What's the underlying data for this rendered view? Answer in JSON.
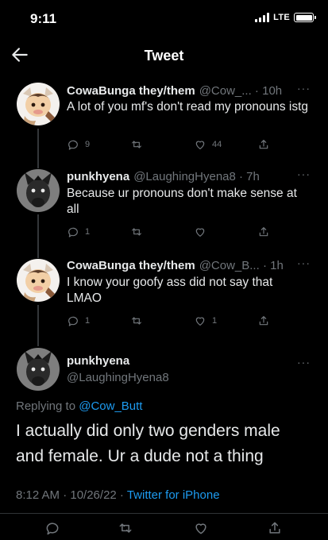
{
  "status_bar": {
    "time": "9:11",
    "network": "LTE"
  },
  "header": {
    "title": "Tweet"
  },
  "thread": [
    {
      "name": "CowaBunga they/them",
      "meta": "@Cow_... · 10h",
      "text": "A lot of you mf's don't read my pronouns istg",
      "replies": "9",
      "retweets": "",
      "likes": "44"
    },
    {
      "name": "punkhyena",
      "meta": "@LaughingHyena8 · 7h",
      "text": "Because ur pronouns don't make sense at all",
      "replies": "1",
      "retweets": "",
      "likes": ""
    },
    {
      "name": "CowaBunga they/them",
      "meta": "@Cow_B... · 1h",
      "text": "I know your goofy ass did not say that LMAO",
      "replies": "1",
      "retweets": "",
      "likes": "1"
    }
  ],
  "main_tweet": {
    "name": "punkhyena",
    "handle": "@LaughingHyena8",
    "replying_prefix": "Replying to",
    "replying_handle": "@Cow_Butt",
    "text": "I actually did only two genders male and female. Ur a dude not a thing",
    "timestamp": "8:12 AM · 10/26/22 ·",
    "client": "Twitter for iPhone"
  },
  "colors": {
    "accent": "#1d9bf0",
    "muted": "#71767b",
    "background": "#000000"
  },
  "icons": [
    "back-arrow-icon",
    "reply-icon",
    "retweet-icon",
    "like-icon",
    "share-icon",
    "more-icon"
  ]
}
